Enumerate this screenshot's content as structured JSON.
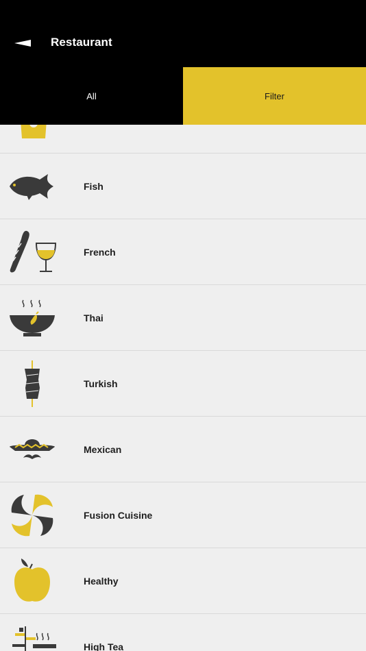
{
  "header": {
    "title": "Restaurant",
    "back_icon": "back-arrow-icon"
  },
  "tabs": [
    {
      "label": "All",
      "active": false
    },
    {
      "label": "Filter",
      "active": true
    }
  ],
  "categories": [
    {
      "label": "Fish",
      "icon": "fish-icon"
    },
    {
      "label": "French",
      "icon": "baguette-wine-icon"
    },
    {
      "label": "Thai",
      "icon": "noodle-bowl-icon"
    },
    {
      "label": "Turkish",
      "icon": "kebab-icon"
    },
    {
      "label": "Mexican",
      "icon": "sombrero-icon"
    },
    {
      "label": "Fusion Cuisine",
      "icon": "fusion-swirl-icon"
    },
    {
      "label": "Healthy",
      "icon": "apple-icon"
    },
    {
      "label": "High Tea",
      "icon": "high-tea-icon"
    }
  ],
  "colors": {
    "accent": "#e3c22b",
    "dark": "#3a3a3a",
    "header": "#000000",
    "background": "#efefef"
  }
}
